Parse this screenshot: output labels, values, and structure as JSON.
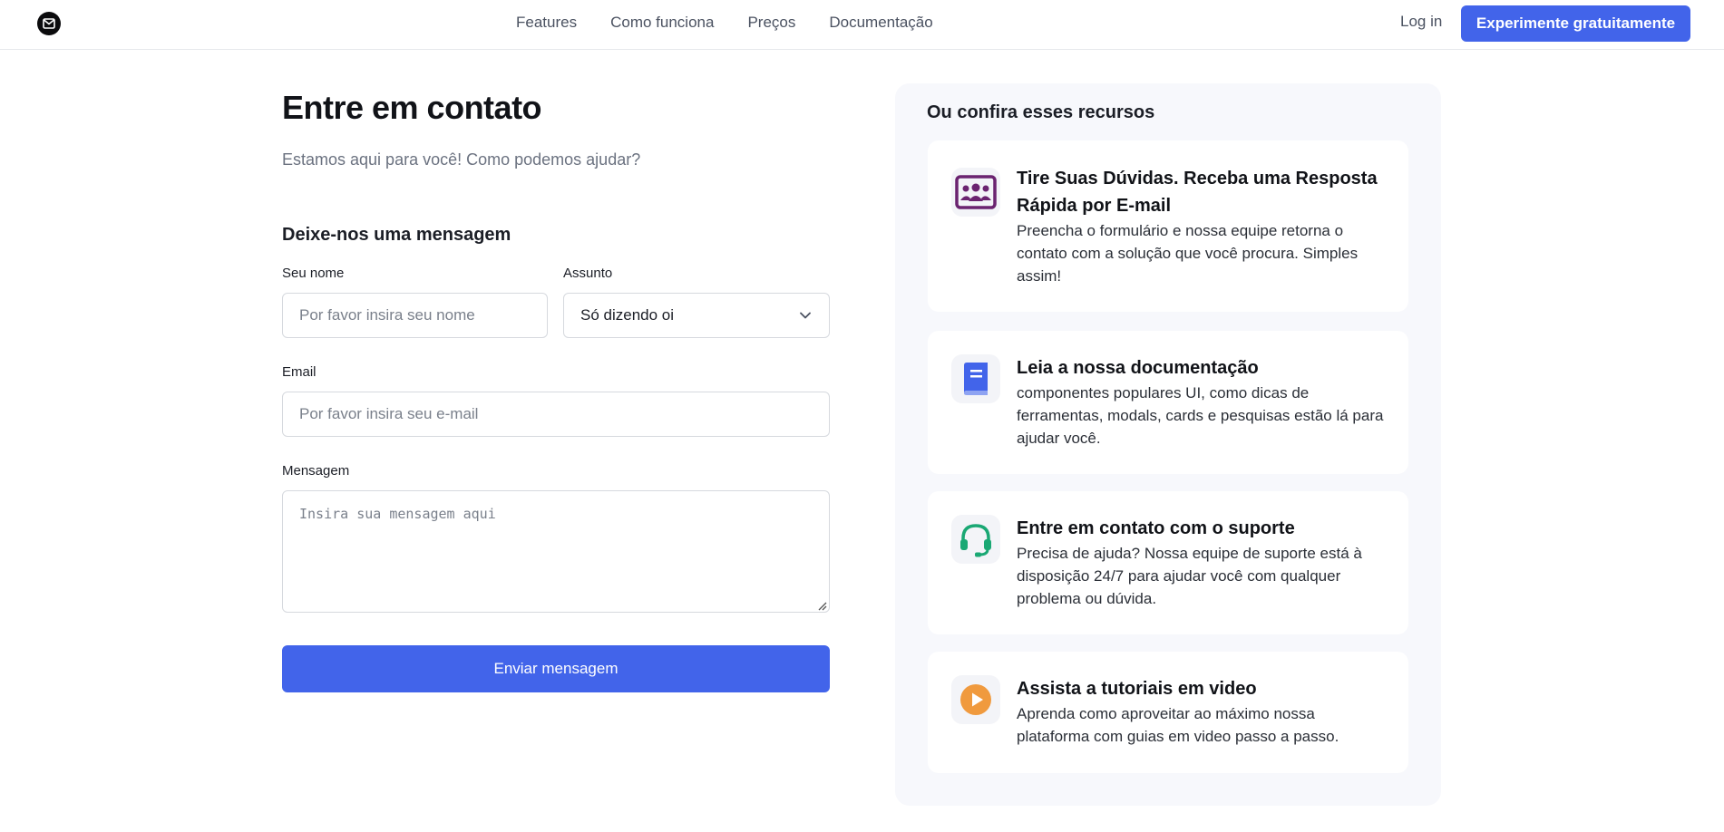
{
  "brand": {
    "logo_icon": "mail-icon"
  },
  "nav": {
    "links": [
      "Features",
      "Como funciona",
      "Preços",
      "Documentação"
    ],
    "login": "Log in",
    "cta": "Experimente gratuitamente"
  },
  "header": {
    "title": "Entre em contato",
    "subtitle": "Estamos aqui para você! Como podemos ajudar?"
  },
  "form": {
    "title": "Deixe-nos uma mensagem",
    "name_label": "Seu nome",
    "name_placeholder": "Por favor insira seu nome",
    "subject_label": "Assunto",
    "subject_value": "Só dizendo oi",
    "email_label": "Email",
    "email_placeholder": "Por favor insira seu e-mail",
    "message_label": "Mensagem",
    "message_placeholder": "Insira sua mensagem aqui",
    "submit_label": "Enviar mensagem"
  },
  "resources": {
    "title": "Ou confira esses recursos",
    "cards": [
      {
        "icon": "team-icon",
        "color": "#6b2370",
        "title": "Tire Suas Dúvidas. Receba uma Resposta Rápida por E-mail",
        "text": "Preencha o formulário e nossa equipe retorna o contato com a solução que você procura. Simples assim!"
      },
      {
        "icon": "book-icon",
        "color": "#4264ea",
        "title": "Leia a nossa documentação",
        "text": "componentes populares UI, como dicas de ferramentas, modals, cards e pesquisas estão lá para ajudar você."
      },
      {
        "icon": "headset-icon",
        "color": "#1aa874",
        "title": "Entre em contato com o suporte",
        "text": "Precisa de ajuda? Nossa equipe de suporte está à disposição 24/7 para ajudar você com qualquer problema ou dúvida."
      },
      {
        "icon": "play-icon",
        "color": "#f09a3e",
        "title": "Assista a tutoriais em video",
        "text": "Aprenda como aproveitar ao máximo nossa plataforma com guias em video passo a passo."
      }
    ]
  },
  "colors": {
    "accent": "#4264ea",
    "panel_bg": "#f7f8fc"
  }
}
